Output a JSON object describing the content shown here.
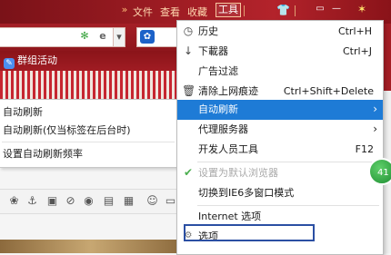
{
  "top_menu": {
    "file": "文件",
    "view": "查看",
    "favorites": "收藏",
    "tools": "工具"
  },
  "favbar": {
    "item": "群组活动"
  },
  "submenu": {
    "items": [
      "自动刷新",
      "自动刷新(仅当标签在后台时)",
      "设置自动刷新频率"
    ]
  },
  "tools_menu": {
    "history": {
      "label": "历史",
      "shortcut": "Ctrl+H"
    },
    "downloads": {
      "label": "下載器",
      "shortcut": "Ctrl+J"
    },
    "ad_filter": {
      "label": "广告过滤"
    },
    "clear_traces": {
      "label": "清除上网痕迹",
      "shortcut": "Ctrl+Shift+Delete"
    },
    "auto_refresh": {
      "label": "自动刷新"
    },
    "proxy": {
      "label": "代理服务器"
    },
    "dev_tools": {
      "label": "开发人员工具",
      "shortcut": "F12"
    },
    "set_default": {
      "label": "设置为默认浏览器"
    },
    "ie6_mode": {
      "label": "切换到IE6多窗口模式"
    },
    "internet_options": {
      "label": "Internet 选项"
    },
    "options": {
      "label": "选项"
    }
  },
  "badge": {
    "count": "41"
  },
  "colors": {
    "chrome_red": "#9b1b22",
    "menu_highlight": "#1e7bd6",
    "options_outline": "#2b4fa3",
    "disabled_text": "#a9a9a9"
  }
}
